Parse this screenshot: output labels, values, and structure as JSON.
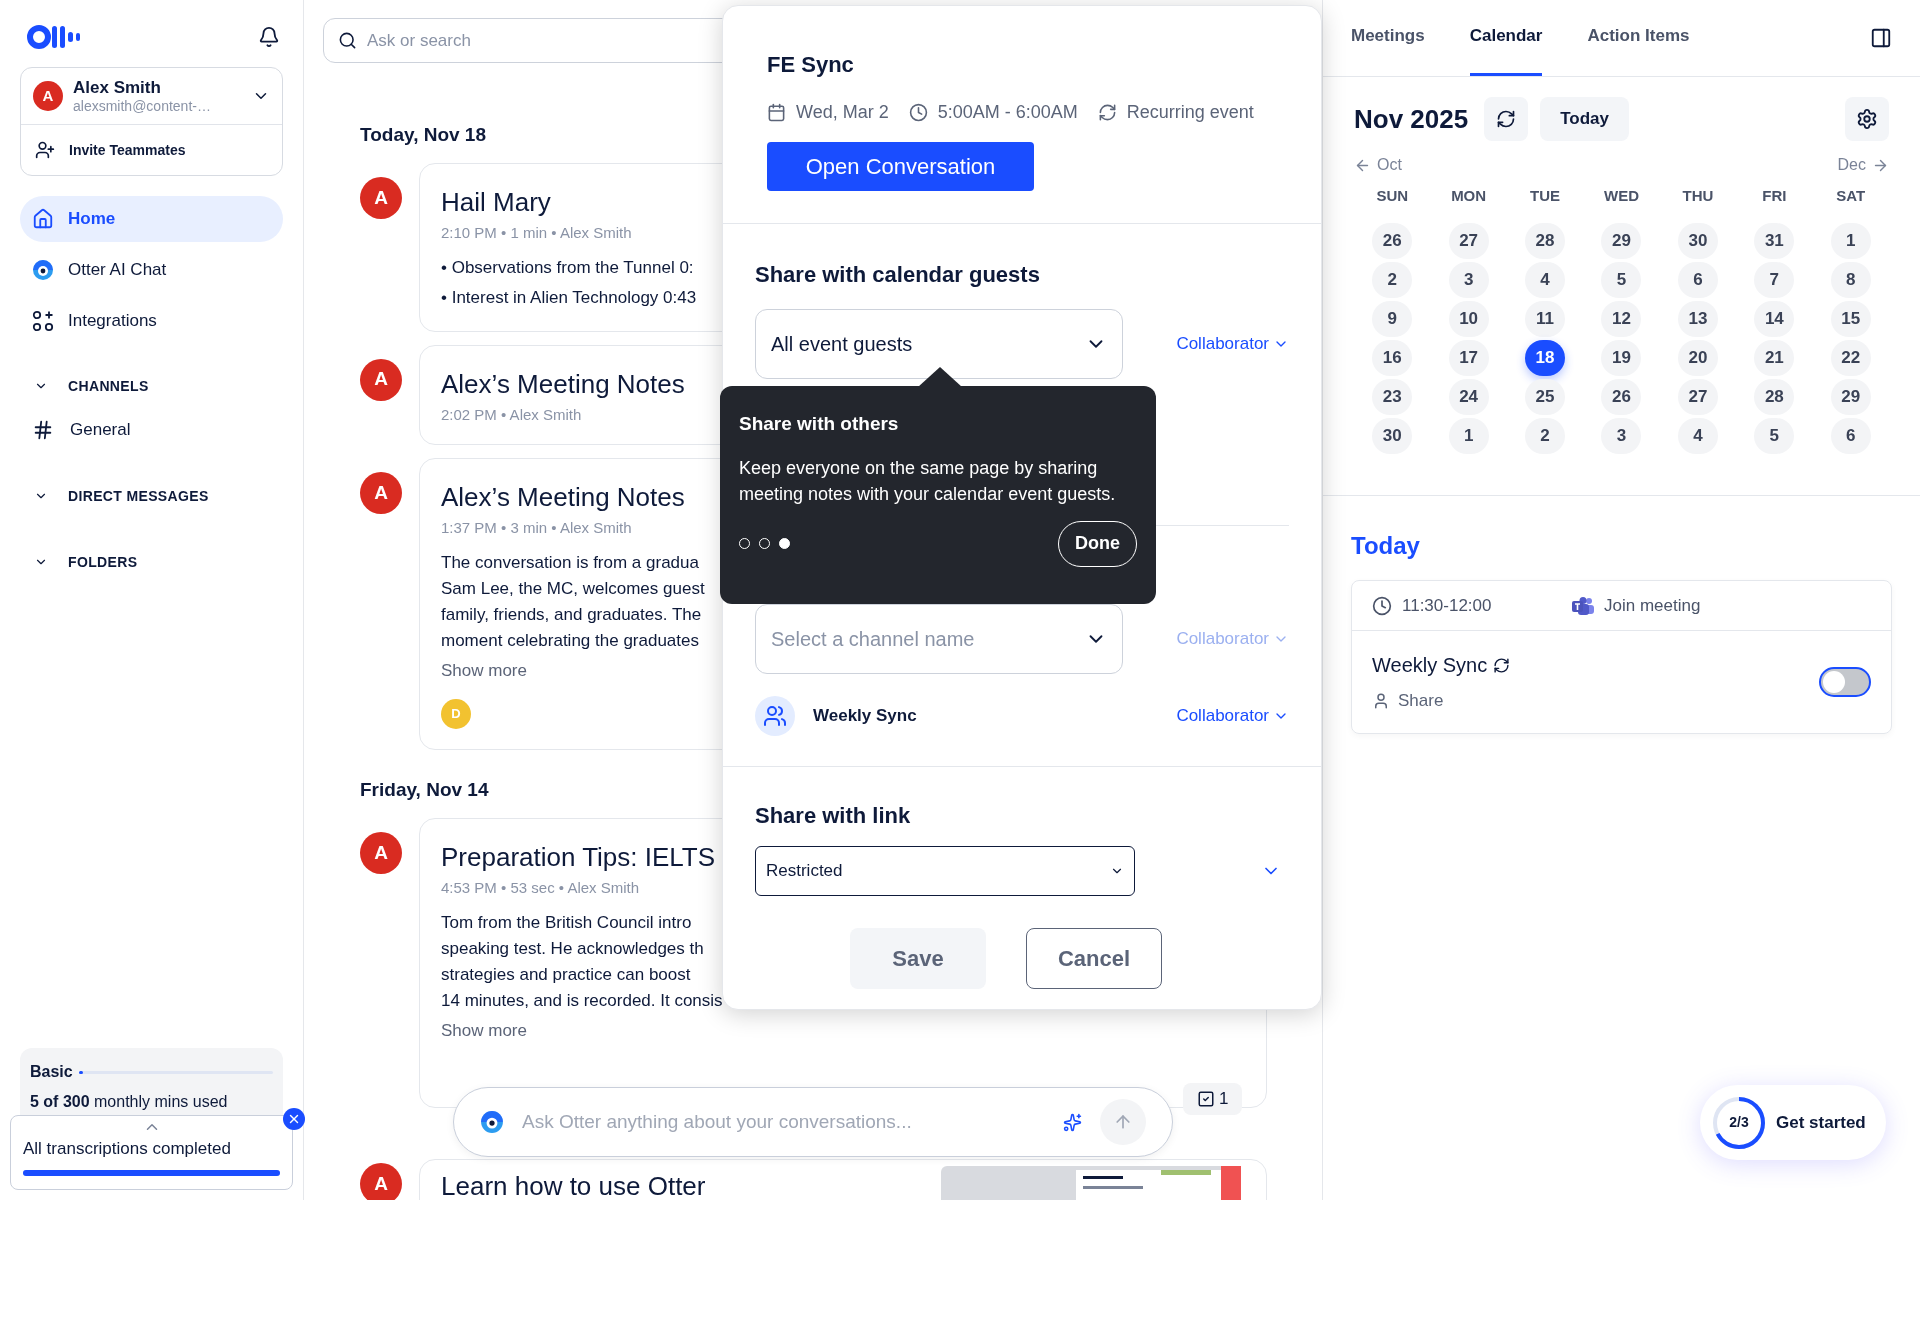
{
  "sidebar": {
    "user": {
      "avatar": "A",
      "name": "Alex Smith",
      "email": "alexsmith@content-…"
    },
    "invite": "Invite Teammates",
    "nav": [
      {
        "label": "Home",
        "selected": true
      },
      {
        "label": "Otter AI Chat",
        "selected": false
      },
      {
        "label": "Integrations",
        "selected": false
      }
    ],
    "sections": [
      {
        "label": "CHANNELS",
        "items": [
          {
            "label": "General"
          }
        ]
      },
      {
        "label": "DIRECT MESSAGES"
      },
      {
        "label": "FOLDERS"
      }
    ],
    "plan": {
      "name": "Basic",
      "level": 0.02,
      "usage": "**5 of 300** monthly mins used"
    },
    "toast": {
      "text": "All transcriptions completed",
      "level": 1
    }
  },
  "search": {
    "placeholder": "Ask or search"
  },
  "feed": [
    {
      "date": "Today, Nov 18",
      "items": [
        {
          "kind": "bullets",
          "avatar": "A",
          "title": "Hail Mary",
          "meta": "2:10 PM • 1 min • Alex Smith",
          "lines": [
            "• Observations from the Tunnel 0:",
            "• Interest in Alien Technology 0:43"
          ]
        },
        {
          "kind": "plain",
          "avatar": "A",
          "title": "Alex’s Meeting Notes",
          "meta": "2:02 PM • Alex Smith"
        },
        {
          "kind": "summary",
          "avatar": "A",
          "title": "Alex’s Meeting Notes",
          "meta": "1:37 PM • 3 min • Alex Smith",
          "lines": [
            "The conversation is from a gradua",
            "Sam Lee, the MC, welcomes guest",
            "family, friends, and graduates. The",
            "moment celebrating the graduates"
          ],
          "show_more": "Show more",
          "participants": [
            {
              "initial": "D",
              "color": "#f2c230"
            }
          ]
        }
      ]
    },
    {
      "date": "Friday, Nov 14",
      "items": [
        {
          "kind": "summary",
          "avatar": "A",
          "title": "Preparation Tips: IELTS",
          "meta": "4:53 PM • 53 sec • Alex Smith",
          "lines": [
            "Tom from the British Council intro",
            "speaking test. He acknowledges th",
            "strategies and practice can boost",
            "14 minutes, and is recorded. It consis"
          ],
          "show_more": "Show more"
        },
        {
          "kind": "promo",
          "avatar": "A",
          "title": "Learn how to use Otter"
        }
      ]
    }
  ],
  "ask_bar": {
    "placeholder": "Ask Otter anything about your conversations..."
  },
  "action_count": "1",
  "modal": {
    "title": "FE Sync",
    "date": "Wed, Mar 2",
    "time": "5:00AM - 6:00AM",
    "recurrence": "Recurring event",
    "open_button": "Open Conversation",
    "guests": {
      "heading": "Share with calendar guests",
      "value": "All event guests",
      "role": "Collaborator"
    },
    "channel": {
      "placeholder": "Select a channel name",
      "role": "Collaborator",
      "disabled": true
    },
    "channel_item": {
      "name": "Weekly Sync",
      "role": "Collaborator"
    },
    "link": {
      "heading": "Share with link",
      "value": "Restricted"
    },
    "buttons": [
      {
        "label": "Save",
        "kind": "secondary"
      },
      {
        "label": "Cancel",
        "kind": "outline"
      }
    ]
  },
  "tooltip": {
    "title": "Share with others",
    "text": "Keep everyone on the same page by sharing meeting notes with your calendar event guests.",
    "steps": [
      {
        "selected": false
      },
      {
        "selected": false
      },
      {
        "selected": true
      }
    ],
    "button": "Done"
  },
  "right_panel": {
    "tabs": [
      {
        "label": "Meetings",
        "selected": false
      },
      {
        "label": "Calendar",
        "selected": true
      },
      {
        "label": "Action Items",
        "selected": false
      }
    ],
    "calendar": {
      "month": "Nov 2025",
      "today_button": "Today",
      "prev": "Oct",
      "next": "Dec",
      "weekdays": [
        "SUN",
        "MON",
        "TUE",
        "WED",
        "THU",
        "FRI",
        "SAT"
      ],
      "weeks": [
        [
          {
            "day": "26",
            "selected": false
          },
          {
            "day": "27",
            "selected": false
          },
          {
            "day": "28",
            "selected": false
          },
          {
            "day": "29",
            "selected": false
          },
          {
            "day": "30",
            "selected": false
          },
          {
            "day": "31",
            "selected": false
          },
          {
            "day": "1",
            "selected": false
          }
        ],
        [
          {
            "day": "2",
            "selected": false
          },
          {
            "day": "3",
            "selected": false
          },
          {
            "day": "4",
            "selected": false
          },
          {
            "day": "5",
            "selected": false
          },
          {
            "day": "6",
            "selected": false
          },
          {
            "day": "7",
            "selected": false
          },
          {
            "day": "8",
            "selected": false
          }
        ],
        [
          {
            "day": "9",
            "selected": false
          },
          {
            "day": "10",
            "selected": false
          },
          {
            "day": "11",
            "selected": false
          },
          {
            "day": "12",
            "selected": false
          },
          {
            "day": "13",
            "selected": false
          },
          {
            "day": "14",
            "selected": false
          },
          {
            "day": "15",
            "selected": false
          }
        ],
        [
          {
            "day": "16",
            "selected": false
          },
          {
            "day": "17",
            "selected": false
          },
          {
            "day": "18",
            "selected": true
          },
          {
            "day": "19",
            "selected": false
          },
          {
            "day": "20",
            "selected": false
          },
          {
            "day": "21",
            "selected": false
          },
          {
            "day": "22",
            "selected": false
          }
        ],
        [
          {
            "day": "23",
            "selected": false
          },
          {
            "day": "24",
            "selected": false
          },
          {
            "day": "25",
            "selected": false
          },
          {
            "day": "26",
            "selected": false
          },
          {
            "day": "27",
            "selected": false
          },
          {
            "day": "28",
            "selected": false
          },
          {
            "day": "29",
            "selected": false
          }
        ],
        [
          {
            "day": "30",
            "selected": false
          },
          {
            "day": "1",
            "selected": false
          },
          {
            "day": "2",
            "selected": false
          },
          {
            "day": "3",
            "selected": false
          },
          {
            "day": "4",
            "selected": false
          },
          {
            "day": "5",
            "selected": false
          },
          {
            "day": "6",
            "selected": false
          }
        ]
      ]
    },
    "today": {
      "heading": "Today",
      "time": "11:30-12:00",
      "join": "Join meeting",
      "event": "Weekly Sync",
      "share": "Share",
      "on": false
    }
  },
  "get_started": {
    "progress": "2/3",
    "label": "Get started"
  }
}
